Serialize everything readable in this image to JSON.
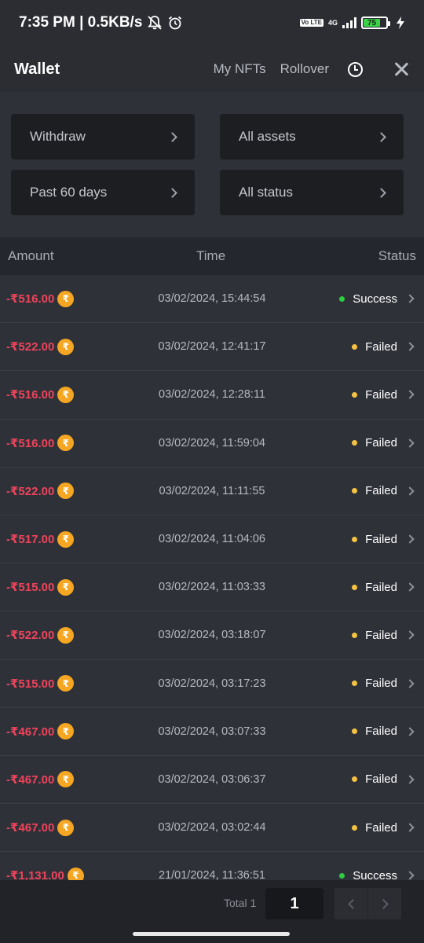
{
  "statusbar": {
    "time_speed": "7:35 PM | 0.5KB/s",
    "network": "4G",
    "volte": "Vo LTE",
    "battery": "75",
    "icons": [
      "bell-muted-icon",
      "alarm-icon",
      "signal-icon",
      "battery-icon",
      "charging-icon"
    ]
  },
  "header": {
    "title": "Wallet",
    "links": [
      "My NFTs",
      "Rollover"
    ],
    "icons": [
      "history-clock-icon",
      "close-icon"
    ]
  },
  "filters": [
    {
      "label": "Withdraw"
    },
    {
      "label": "All assets"
    },
    {
      "label": "Past 60 days"
    },
    {
      "label": "All status"
    }
  ],
  "table": {
    "headers": {
      "amount": "Amount",
      "time": "Time",
      "status": "Status"
    },
    "coin_symbol": "₹",
    "rows": [
      {
        "amount": "-₹516.00",
        "time": "03/02/2024, 15:44:54",
        "status": "Success"
      },
      {
        "amount": "-₹522.00",
        "time": "03/02/2024, 12:41:17",
        "status": "Failed"
      },
      {
        "amount": "-₹516.00",
        "time": "03/02/2024, 12:28:11",
        "status": "Failed"
      },
      {
        "amount": "-₹516.00",
        "time": "03/02/2024, 11:59:04",
        "status": "Failed"
      },
      {
        "amount": "-₹522.00",
        "time": "03/02/2024, 11:11:55",
        "status": "Failed"
      },
      {
        "amount": "-₹517.00",
        "time": "03/02/2024, 11:04:06",
        "status": "Failed"
      },
      {
        "amount": "-₹515.00",
        "time": "03/02/2024, 11:03:33",
        "status": "Failed"
      },
      {
        "amount": "-₹522.00",
        "time": "03/02/2024, 03:18:07",
        "status": "Failed"
      },
      {
        "amount": "-₹515.00",
        "time": "03/02/2024, 03:17:23",
        "status": "Failed"
      },
      {
        "amount": "-₹467.00",
        "time": "03/02/2024, 03:07:33",
        "status": "Failed"
      },
      {
        "amount": "-₹467.00",
        "time": "03/02/2024, 03:06:37",
        "status": "Failed"
      },
      {
        "amount": "-₹467.00",
        "time": "03/02/2024, 03:02:44",
        "status": "Failed"
      },
      {
        "amount": "-₹1,131.00",
        "time": "21/01/2024, 11:36:51",
        "status": "Success"
      }
    ]
  },
  "colors": {
    "amount": "#f0435b",
    "coin": "#f5a623",
    "success_dot": "#2ecc40",
    "failed_dot": "#f5c242"
  },
  "pagination": {
    "total_label": "Total 1",
    "current_page": "1"
  }
}
